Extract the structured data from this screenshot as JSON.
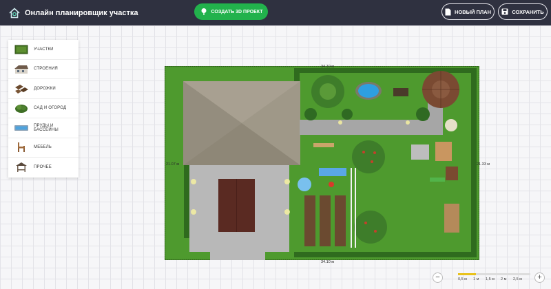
{
  "app": {
    "title": "Онлайн планировщик участка"
  },
  "header": {
    "create_label": "СОЗДАТЬ 3D ПРОЕКТ",
    "new_label": "НОВЫЙ ПЛАН",
    "save_label": "СОХРАНИТЬ"
  },
  "sidebar": {
    "items": [
      {
        "label": "УЧАСТКИ",
        "icon": "lawn-plot-icon"
      },
      {
        "label": "СТРОЕНИЯ",
        "icon": "house-icon"
      },
      {
        "label": "ДОРОЖКИ",
        "icon": "paving-tiles-icon"
      },
      {
        "label": "САД И ОГОРОД",
        "icon": "shrub-icon"
      },
      {
        "label": "ПРУДЫ И БАССЕЙНЫ",
        "icon": "pool-icon"
      },
      {
        "label": "МЕБЕЛЬ",
        "icon": "chair-icon"
      },
      {
        "label": "ПРОЧЕЕ",
        "icon": "gazebo-icon"
      }
    ]
  },
  "plan": {
    "dims": {
      "top": "34.10 м",
      "bottom": "34.10 м",
      "left": "21.07 м",
      "right": "21.33 м"
    }
  },
  "zoom": {
    "minus": "−",
    "plus": "+",
    "ticks": [
      "0,5 м",
      "1 м",
      "1,5 м",
      "2 м",
      "2,5 м"
    ],
    "level": 0.25
  },
  "colors": {
    "accent": "#22b24c",
    "header_bg": "#2f3140",
    "grass": "#4e9a2e",
    "roof": "#9b9484",
    "shed_roof": "#5a2a22",
    "scale_fill": "#e9c21a"
  }
}
